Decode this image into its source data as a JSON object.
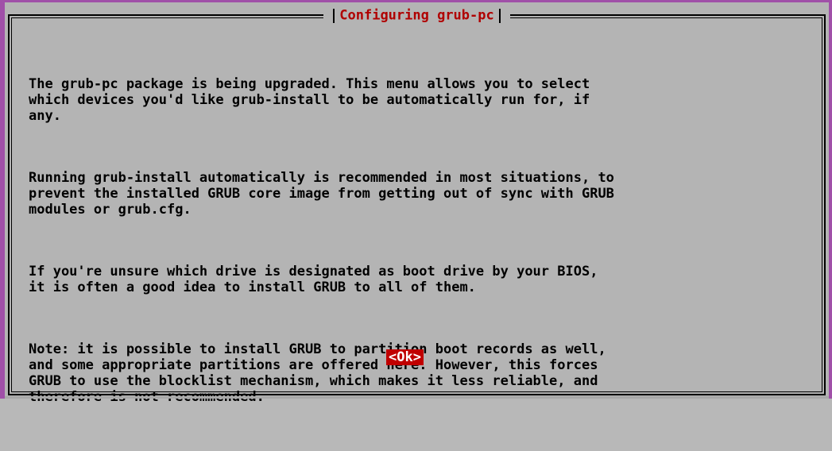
{
  "dialog": {
    "title": "Configuring grub-pc",
    "paragraphs": [
      "The grub-pc package is being upgraded. This menu allows you to select\nwhich devices you'd like grub-install to be automatically run for, if\nany.",
      "Running grub-install automatically is recommended in most situations, to\nprevent the installed GRUB core image from getting out of sync with GRUB\nmodules or grub.cfg.",
      "If you're unsure which drive is designated as boot drive by your BIOS,\nit is often a good idea to install GRUB to all of them.",
      "Note: it is possible to install GRUB to partition boot records as well,\nand some appropriate partitions are offered here. However, this forces\nGRUB to use the blocklist mechanism, which makes it less reliable, and\ntherefore is not recommended."
    ],
    "ok_label": "<Ok>"
  },
  "colors": {
    "background": "#b4b4b4",
    "title": "#b00000",
    "button_bg": "#c00000",
    "button_text": "#ffffff",
    "screen_edge": "#a050a8"
  }
}
